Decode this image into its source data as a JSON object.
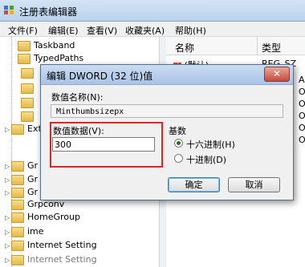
{
  "window": {
    "title": "注册表编辑器"
  },
  "menu": [
    "文件(F)",
    "编辑(E)",
    "查看(V)",
    "收藏夹(A)",
    "帮助(H)"
  ],
  "tree": {
    "items": [
      {
        "label": "Taskband",
        "indent": 2
      },
      {
        "label": "TypedPaths",
        "indent": 2
      },
      {
        "label": "Ext",
        "indent": 0
      },
      {
        "label": "Gr",
        "indent": 0
      },
      {
        "label": "Gr",
        "indent": 0
      },
      {
        "label": "Gr",
        "indent": 0
      },
      {
        "label": "Grpconv",
        "indent": 0
      },
      {
        "label": "HomeGroup",
        "indent": 0
      },
      {
        "label": "ime",
        "indent": 0
      },
      {
        "label": "Internet Setting",
        "indent": 0
      },
      {
        "label": "Internet Setting",
        "indent": 0
      }
    ]
  },
  "list": {
    "col_name": "名称",
    "col_type": "类型",
    "rows": [
      {
        "name": "(默认)",
        "type": "REG_SZ"
      },
      {
        "name": "",
        "type": "AR"
      },
      {
        "name": "",
        "type": "OR"
      },
      {
        "name": "",
        "type": "OR"
      },
      {
        "name": "",
        "type": "OR"
      },
      {
        "name": "",
        "type": "OR"
      },
      {
        "name": "",
        "type": "OR"
      }
    ]
  },
  "dialog": {
    "title": "编辑 DWORD (32 位)值",
    "close_glyph": "✕",
    "value_name_label": "数值名称(N):",
    "value_name": "Minthumbsizepx",
    "value_data_label": "数值数据(V):",
    "value_data": "300",
    "base_label": "基数",
    "base_options": [
      "十六进制(H)",
      "十进制(D)"
    ],
    "base_selected": 0,
    "ok_label": "确定",
    "cancel_label": "取消"
  },
  "colors": {
    "highlight": "#e0242a"
  }
}
